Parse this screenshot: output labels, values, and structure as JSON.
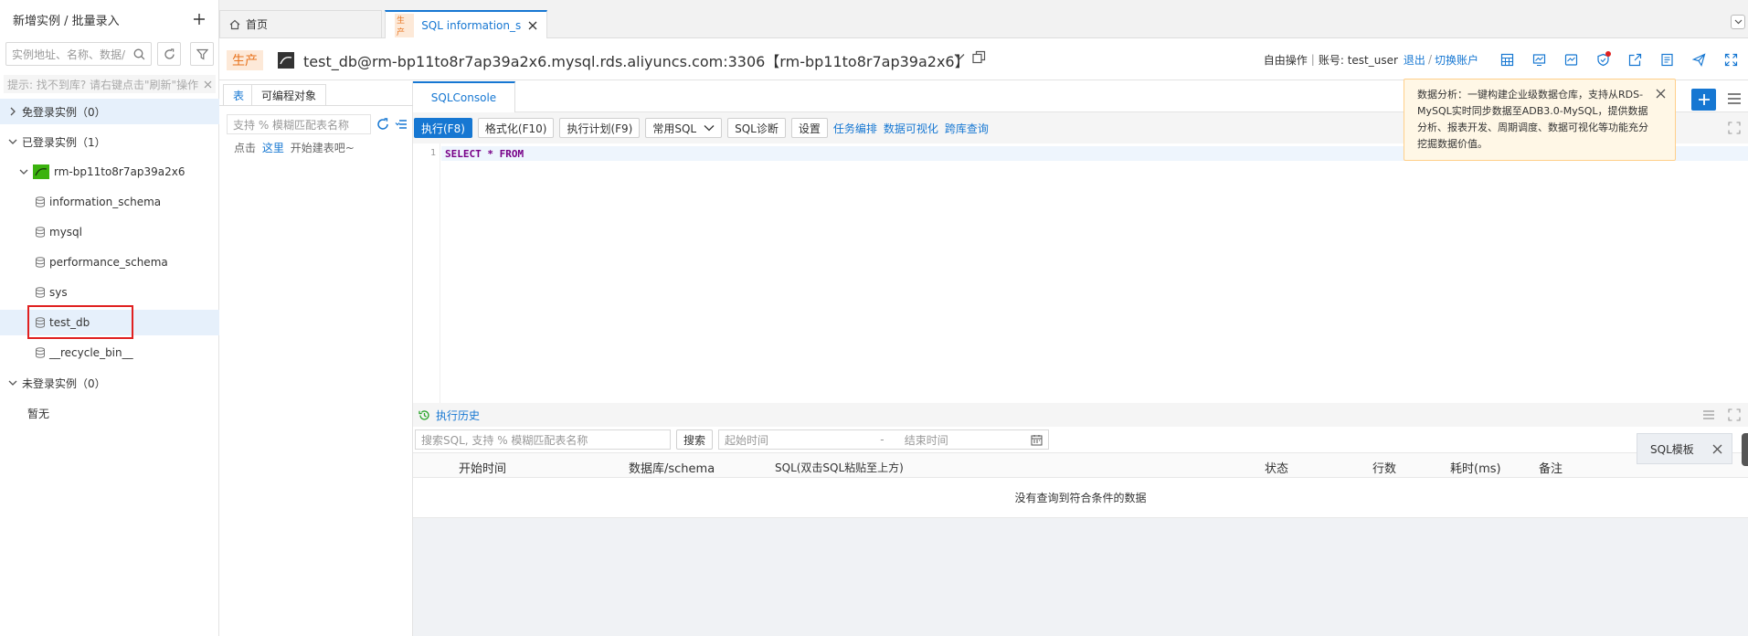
{
  "left_panel": {
    "header_title": "新增实例 / 批量录入",
    "search_placeholder": "实例地址、名称、数据/",
    "tip": "提示: 找不到库? 请右键点击\"刷新\"操作",
    "tree": {
      "free_login_label": "免登录实例（0）",
      "logged_label": "已登录实例（1）",
      "instance": "rm-bp11to8r7ap39a2x6",
      "databases": [
        "information_schema",
        "mysql",
        "performance_schema",
        "sys",
        "test_db",
        "__recycle_bin__"
      ],
      "not_logged_label": "未登录实例（0）",
      "none_label": "暂无"
    }
  },
  "tabs": {
    "home_label": "首页",
    "sql_env": "生产",
    "sql_label": "SQL information_scl"
  },
  "header": {
    "env": "生产",
    "connection": "test_db@rm-bp11to8r7ap39a2x6.mysql.rds.aliyuncs.com:3306【rm-bp11to8r7ap39a2x6】",
    "mode_label": "自由操作",
    "account_label": "账号: test_user",
    "logout_label": "退出",
    "switch_label": "切换账户"
  },
  "object_panel": {
    "tab_table": "表",
    "tab_programmable": "可编程对象",
    "search_placeholder": "支持 % 模糊匹配表名称",
    "create_prefix": "点击",
    "create_link": "这里",
    "create_suffix": "开始建表吧~"
  },
  "console": {
    "tab_label": "SQLConsole",
    "toolbar": {
      "execute": "执行(F8)",
      "format": "格式化(F10)",
      "plan": "执行计划(F9)",
      "common_sql": "常用SQL",
      "diagnose": "SQL诊断",
      "settings": "设置",
      "task_orchestration": "任务编排",
      "visualization": "数据可视化",
      "cross_db": "跨库查询"
    },
    "line_number": "1",
    "sql_text": "SELECT * FROM"
  },
  "history": {
    "title": "执行历史",
    "search_placeholder": "搜索SQL, 支持 % 模糊匹配表名称",
    "search_button": "搜索",
    "start_placeholder": "起始时间",
    "range_sep": "-",
    "end_placeholder": "结束时间",
    "columns": [
      "开始时间",
      "数据库/schema",
      "SQL(双击SQL粘贴至上方)",
      "状态",
      "行数",
      "耗时(ms)",
      "备注"
    ],
    "empty_text": "没有查询到符合条件的数据"
  },
  "popup": {
    "text": "数据分析：一键构建企业级数据仓库，支持从RDS-MySQL实时同步数据至ADB3.0-MySQL，提供数据分析、报表开发、周期调度、数据可视化等功能充分挖掘数据价值。"
  },
  "sql_template": {
    "label": "SQL模板"
  },
  "colors": {
    "accent": "#1677d2",
    "env_tag": "#e8721c",
    "highlight_box": "#e02020"
  }
}
